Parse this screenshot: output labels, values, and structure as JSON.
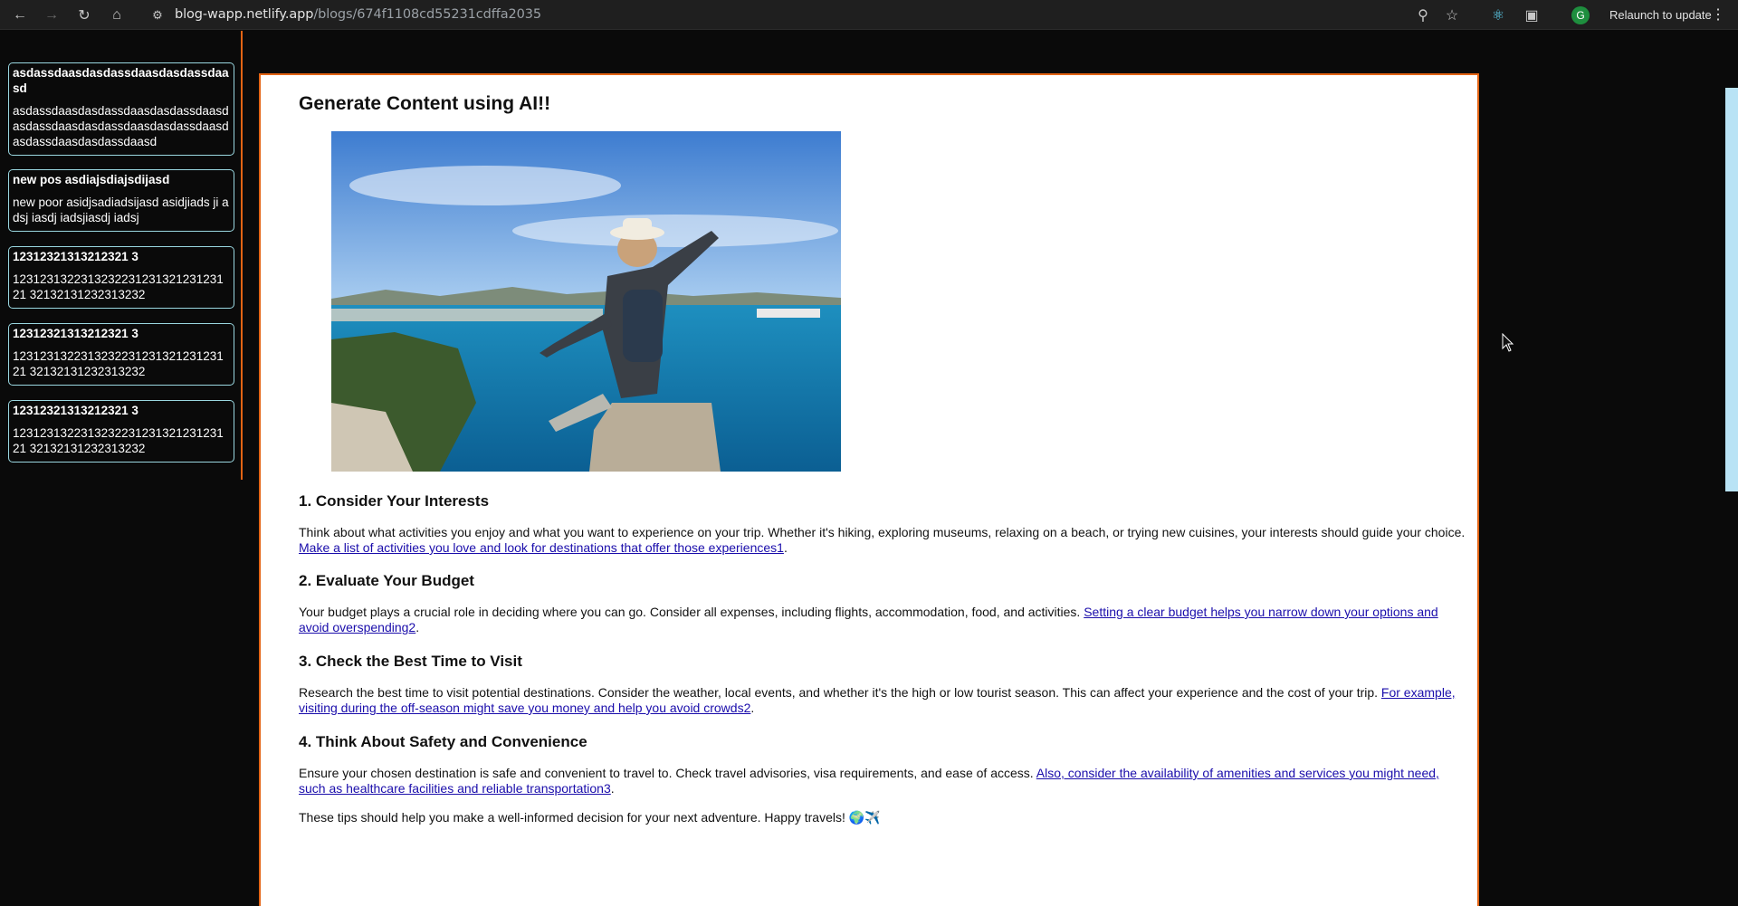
{
  "browser": {
    "url_host": "blog-wapp.netlify.app",
    "url_path": "/blogs/674f1108cd55231cdffa2035",
    "avatar_letter": "G",
    "relaunch_label": "Relaunch to update"
  },
  "sidebar": {
    "posts": [
      {
        "title": "asdassdaasdasdassdaasdasdassdaasd",
        "body": "asdassdaasdasdassdaasdasdassdaasdasdassdaasdasdassdaasdasdassdaasdasdassdaasdasdassdaasd"
      },
      {
        "title": "new pos asdiajsdiajsdijasd",
        "body": "new poor asidjsadiadsijasd asidjiads ji adsj iasdj iadsjiasdj iadsj"
      },
      {
        "title": "12312321313212321 3",
        "body": "123123132231323223123132123123121 32132131232313232"
      },
      {
        "title": "12312321313212321 3",
        "body": "123123132231323223123132123123121 32132131232313232"
      },
      {
        "title": "12312321313212321 3",
        "body": "123123132231323223123132123123121 32132131232313232"
      }
    ]
  },
  "article": {
    "heading": "Generate Content using AI!!",
    "sections": [
      {
        "title": "1. Consider Your Interests",
        "text": "Think about what activities you enjoy and what you want to experience on your trip. Whether it's hiking, exploring museums, relaxing on a beach, or trying new cuisines, your interests should guide your choice. ",
        "link": "Make a list of activities you love and look for destinations that offer those experiences1"
      },
      {
        "title": "2. Evaluate Your Budget",
        "text": "Your budget plays a crucial role in deciding where you can go. Consider all expenses, including flights, accommodation, food, and activities. ",
        "link": "Setting a clear budget helps you narrow down your options and avoid overspending2"
      },
      {
        "title": "3. Check the Best Time to Visit",
        "text": "Research the best time to visit potential destinations. Consider the weather, local events, and whether it's the high or low tourist season. This can affect your experience and the cost of your trip. ",
        "link": "For example, visiting during the off-season might save you money and help you avoid crowds2"
      },
      {
        "title": "4. Think About Safety and Convenience",
        "text": "Ensure your chosen destination is safe and convenient to travel to. Check travel advisories, visa requirements, and ease of access. ",
        "link": "Also, consider the availability of amenities and services you might need, such as healthcare facilities and reliable transportation3"
      }
    ],
    "closing": "These tips should help you make a well-informed decision for your next adventure. Happy travels! 🌍✈️"
  }
}
